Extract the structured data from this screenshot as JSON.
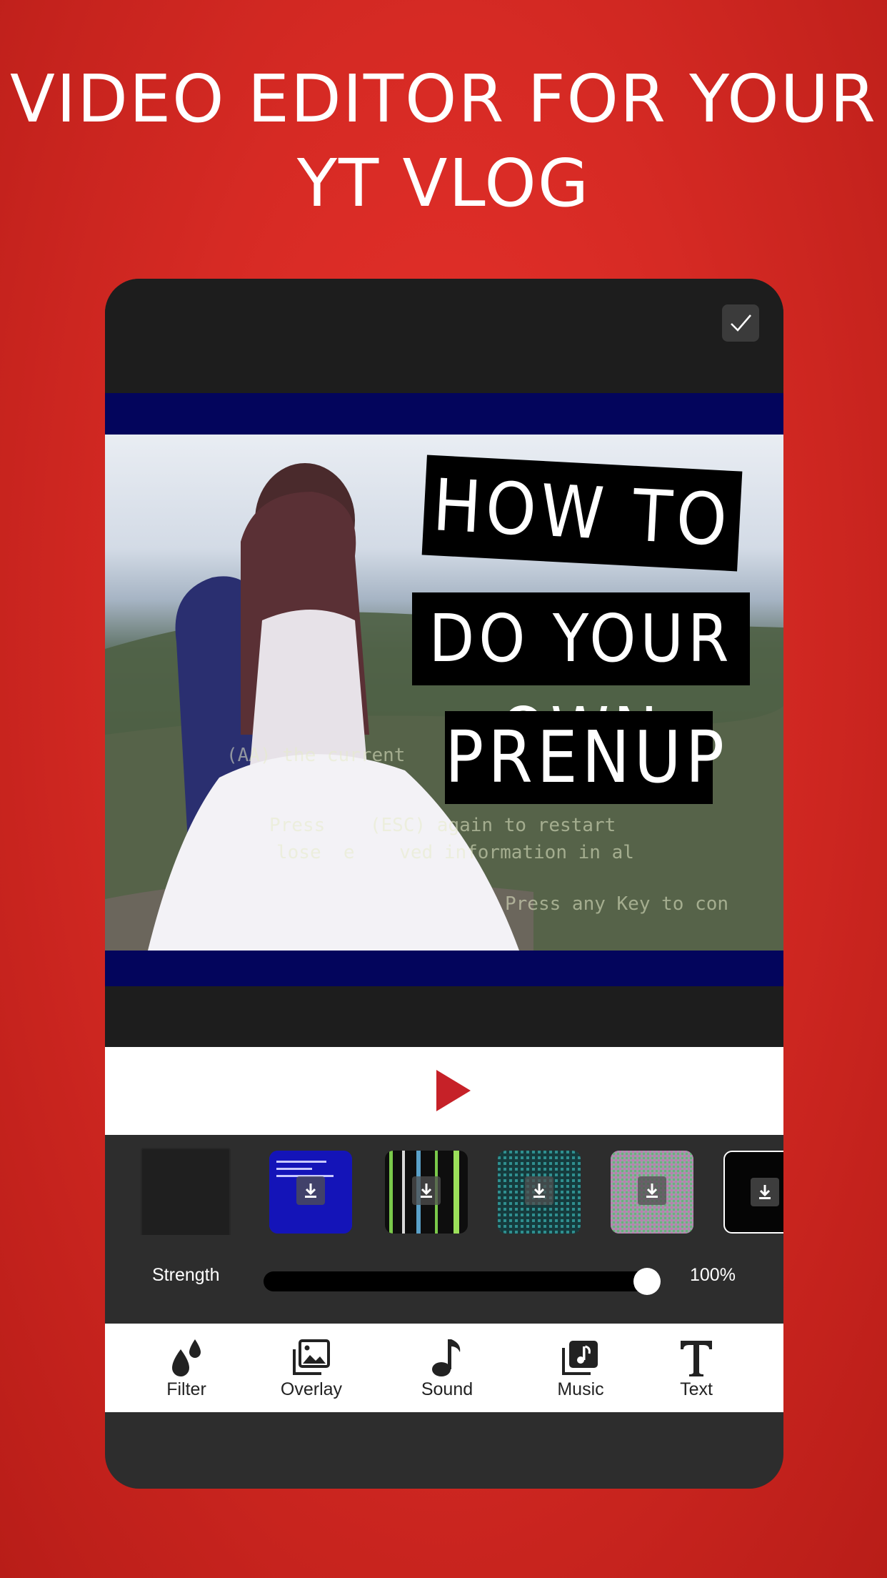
{
  "headline": {
    "line1": "VIDEO EDITOR FOR YOUR",
    "line2": "YT VLOG"
  },
  "video": {
    "captions": [
      "HOW TO",
      "DO YOUR OWN",
      "PRENUP"
    ],
    "glitch_lines": [
      "(AA) the current",
      "Press    (ESC) again to restart",
      "lose  e    ved information in al",
      "Press any Key to con"
    ]
  },
  "strength": {
    "label": "Strength",
    "value_text": "100%",
    "value": 1.0
  },
  "thumbnails": [
    "none",
    "blue-screen",
    "green-stripes",
    "teal-noise",
    "static-noise",
    "terminal"
  ],
  "toolbar": {
    "items": [
      {
        "label": "Filter",
        "icon": "drops-icon"
      },
      {
        "label": "Overlay",
        "icon": "images-icon"
      },
      {
        "label": "Sound",
        "icon": "note-icon"
      },
      {
        "label": "Music",
        "icon": "music-library-icon"
      },
      {
        "label": "Text",
        "icon": "text-T-icon"
      }
    ]
  },
  "colors": {
    "background": "#d62a24",
    "play": "#c62128",
    "panel": "#2d2d2d",
    "video_border": "#03055c"
  }
}
